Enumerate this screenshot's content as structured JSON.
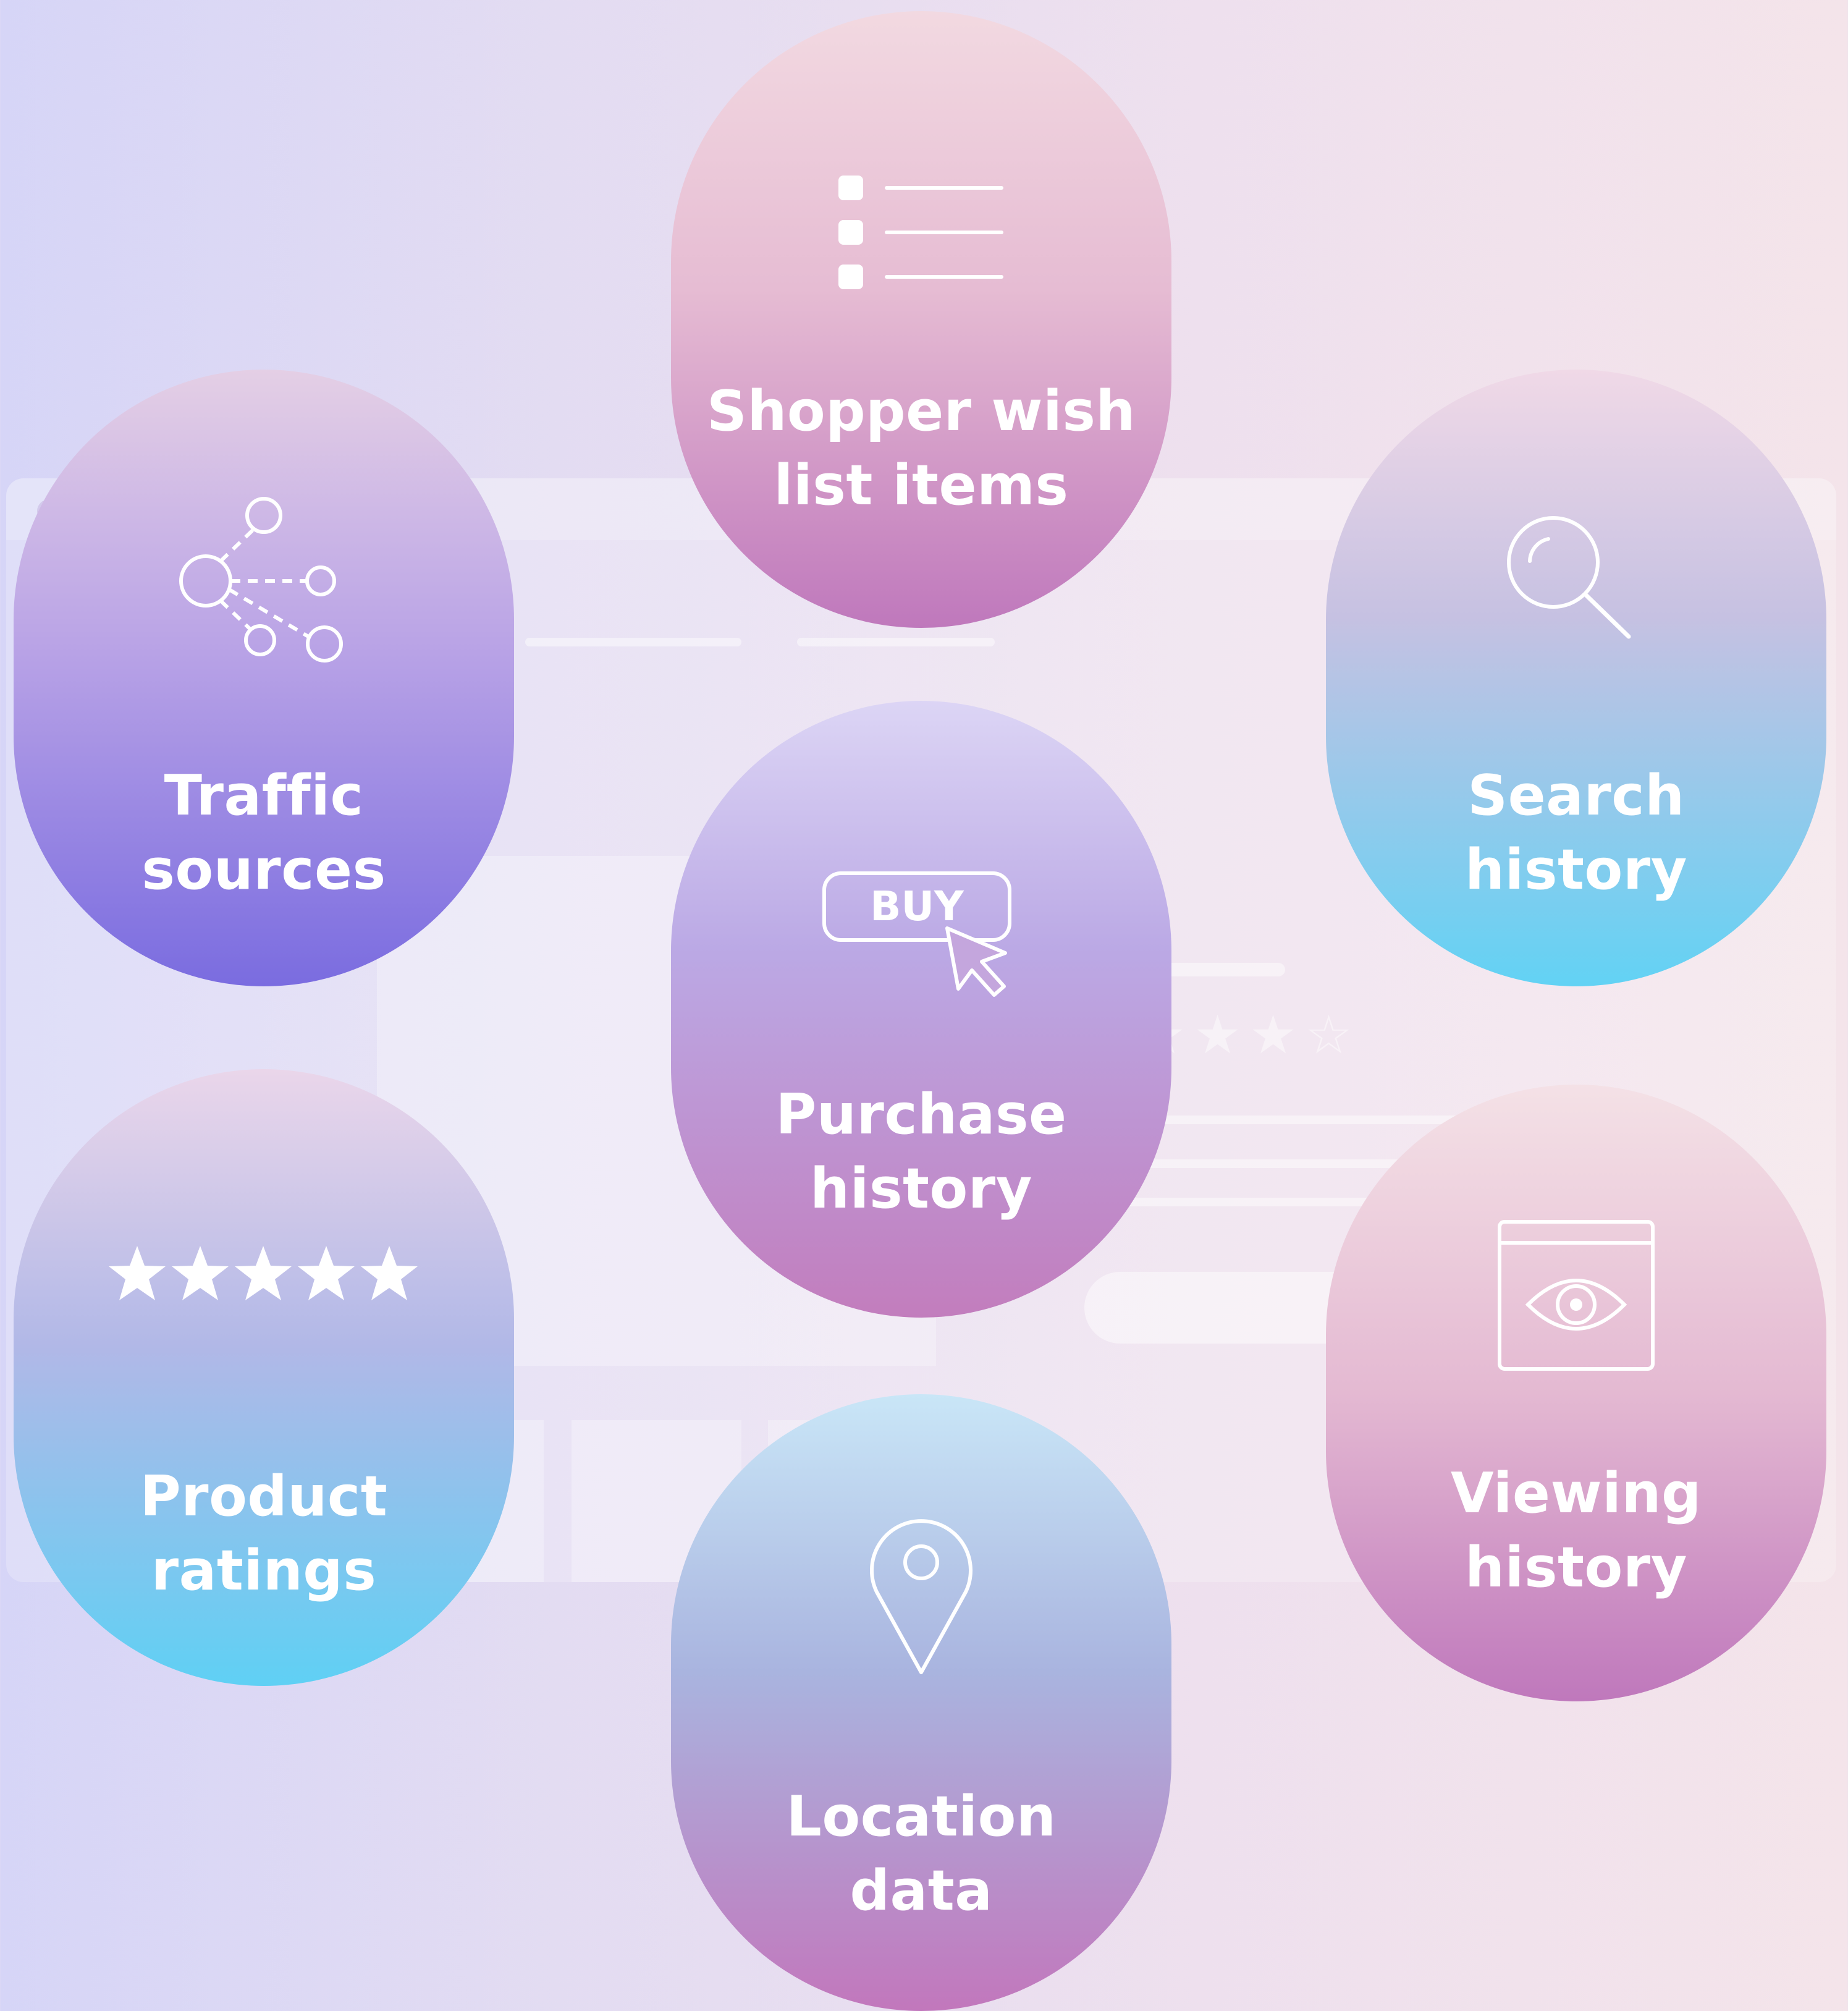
{
  "items": {
    "wish": {
      "label": "Shopper wish\nlist items",
      "icon": "list-icon"
    },
    "traffic": {
      "label": "Traffic\nsources",
      "icon": "network-icon"
    },
    "search": {
      "label": "Search\nhistory",
      "icon": "search-icon"
    },
    "purchase": {
      "label": "Purchase\nhistory",
      "icon": "buy-button-icon",
      "button_text": "BUY"
    },
    "ratings": {
      "label": "Product\nratings",
      "icon": "star-rating-icon"
    },
    "viewing": {
      "label": "Viewing\nhistory",
      "icon": "eye-window-icon"
    },
    "location": {
      "label": "Location\ndata",
      "icon": "map-pin-icon"
    }
  }
}
